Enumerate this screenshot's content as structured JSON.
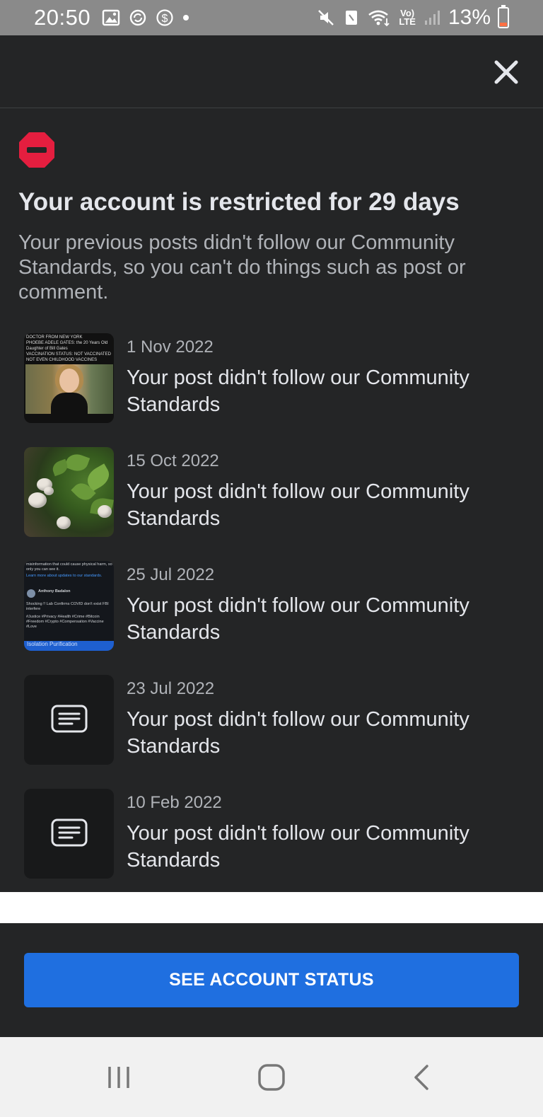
{
  "status_bar": {
    "time": "20:50",
    "battery": "13%",
    "network": "LTE",
    "icons": [
      "gallery-icon",
      "sync-icon",
      "dollar-icon",
      "dot-icon",
      "mute-icon",
      "nfc-icon",
      "wifi-icon",
      "volte-icon",
      "signal-icon",
      "battery-icon"
    ]
  },
  "header": {
    "close_icon": "close-icon"
  },
  "main": {
    "status_icon": "restricted-icon",
    "title": "Your account is restricted for 29 days",
    "subtitle": "Your previous posts didn't follow our Community Standards, so you can't do things such as post or comment."
  },
  "violations": [
    {
      "date": "1 Nov 2022",
      "text": "Your post didn't follow our Community Standards",
      "thumbnail": {
        "header_lines": [
          "DOCTOR FROM NEW YORK",
          "PHOEBE ADELE GATES: the 20 Years Old",
          "Daughter of Bill Gates",
          "VACCINATION STATUS: NOT VACCINATED",
          "NOT EVEN CHILDHOOD VACCINES"
        ]
      }
    },
    {
      "date": "15 Oct 2022",
      "text": "Your post didn't follow our Community Standards"
    },
    {
      "date": "25 Jul 2022",
      "text": "Your post didn't follow our Community Standards",
      "thumbnail": {
        "top_text": "misinformation that could cause physical harm, so only you can see it.",
        "link_text": "Learn more about updates to our standards.",
        "author": "Anthony Badalon",
        "body": "Shocking !! Lab Confirms COVID don't exist FBI interfere",
        "tags": "#Justice #Privacy #Health #Crime #Bitcoin #Freedom #Crypto #Compensation #Vaccine #Love",
        "bar_text": "Isolation  Purification"
      }
    },
    {
      "date": "23 Jul 2022",
      "text": "Your post didn't follow our Community Standards",
      "thumbnail_icon": "text-post-icon"
    },
    {
      "date": "10 Feb 2022",
      "text": "Your post didn't follow our Community Standards",
      "thumbnail_icon": "text-post-icon"
    }
  ],
  "footer": {
    "button_label": "SEE ACCOUNT STATUS",
    "button_color": "#1f6fe0"
  },
  "nav_bar": {
    "buttons": [
      "recent-apps-icon",
      "home-icon",
      "back-icon"
    ]
  },
  "colors": {
    "background": "#242526",
    "restricted_red": "#e41e3f"
  }
}
